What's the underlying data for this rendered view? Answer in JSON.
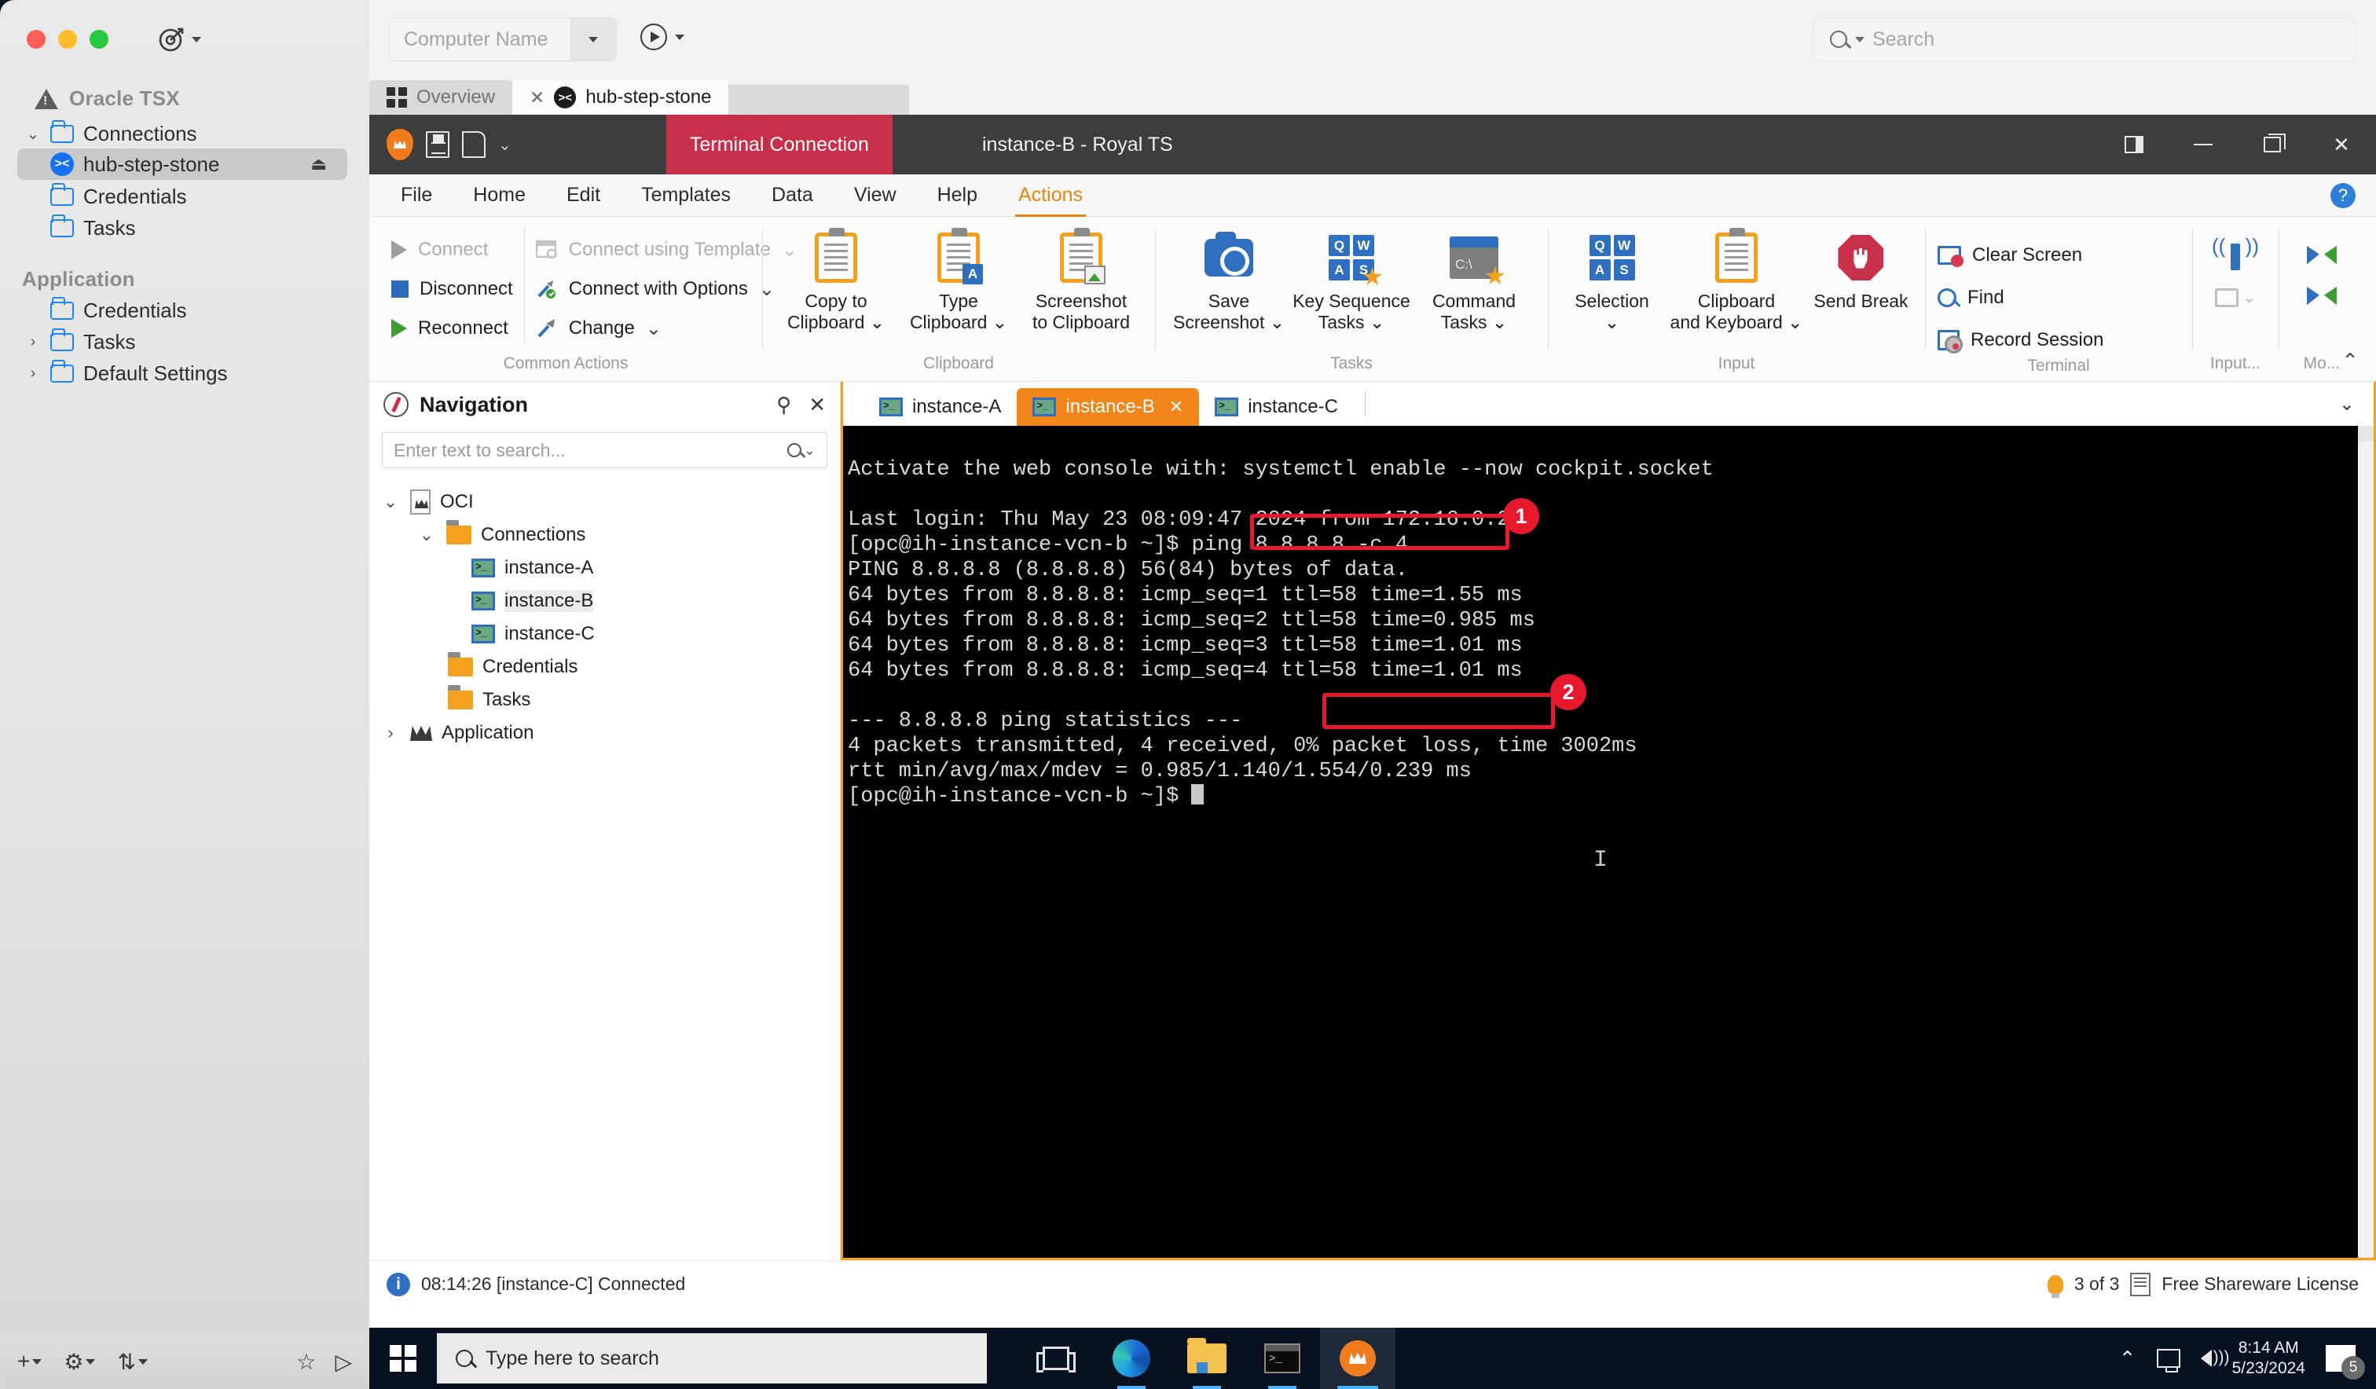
{
  "mac_sidebar": {
    "group1_title": "Oracle TSX",
    "items": [
      {
        "label": "Connections",
        "icon": "folder-icon",
        "twisty": "chevron-down"
      },
      {
        "label": "hub-step-stone",
        "icon": "xshell-icon",
        "selected": true,
        "trailing": "eject-icon"
      },
      {
        "label": "Credentials",
        "icon": "folder-icon"
      },
      {
        "label": "Tasks",
        "icon": "folder-icon"
      }
    ],
    "group2_title": "Application",
    "items2": [
      {
        "label": "Credentials",
        "icon": "folder-icon"
      },
      {
        "label": "Tasks",
        "icon": "folder-icon",
        "twisty": "chevron-right"
      },
      {
        "label": "Default Settings",
        "icon": "folder-icon",
        "twisty": "chevron-right"
      }
    ],
    "bottom_icons": [
      "plus-icon",
      "gear-icon",
      "transfer-icon",
      "star-icon",
      "play-icon"
    ]
  },
  "host_top": {
    "computer_name_placeholder": "Computer Name",
    "search_placeholder": "Search"
  },
  "host_tabs": [
    {
      "label": "Overview",
      "icon": "grid-icon",
      "active": false
    },
    {
      "label": "hub-step-stone",
      "icon": "xshell-icon",
      "active": true,
      "closable": true
    }
  ],
  "rts": {
    "connection_type_badge": "Terminal Connection",
    "window_title": "instance-B - Royal TS",
    "menu": [
      "File",
      "Home",
      "Edit",
      "Templates",
      "Data",
      "View",
      "Help",
      "Actions"
    ],
    "menu_active": "Actions",
    "window_buttons": [
      "panel-icon",
      "minimize-icon",
      "restore-icon",
      "close-icon"
    ],
    "help_button": "?"
  },
  "ribbon": {
    "groups": [
      {
        "label": "Common Actions",
        "simple_left": [
          {
            "label": "Connect",
            "icon": "play-icon",
            "disabled": true
          },
          {
            "label": "Disconnect",
            "icon": "stop-square-icon",
            "disabled": false
          },
          {
            "label": "Reconnect",
            "icon": "play-green-icon",
            "disabled": false
          }
        ],
        "simple_right": [
          {
            "label": "Connect using Template",
            "icon": "template-icon",
            "disabled": true,
            "caret": true
          },
          {
            "label": "Connect with Options",
            "icon": "wrench-icon",
            "disabled": false,
            "caret": true
          },
          {
            "label": "Change",
            "icon": "hammer-icon",
            "disabled": false,
            "caret": true
          }
        ]
      },
      {
        "label": "Clipboard",
        "buttons": [
          {
            "line1": "Copy to",
            "line2": "Clipboard",
            "icon": "clipboard-icon",
            "caret": true
          },
          {
            "line1": "Type",
            "line2": "Clipboard",
            "icon": "clipboard-type-icon",
            "caret": true
          },
          {
            "line1": "Screenshot",
            "line2": "to Clipboard",
            "icon": "clipboard-image-icon",
            "caret": false
          }
        ]
      },
      {
        "label": "Tasks",
        "buttons": [
          {
            "line1": "Save",
            "line2": "Screenshot",
            "icon": "camera-icon",
            "caret": true
          },
          {
            "line1": "Key Sequence",
            "line2": "Tasks",
            "icon": "keys-star-icon",
            "caret": true
          },
          {
            "line1": "Command",
            "line2": "Tasks",
            "icon": "command-star-icon",
            "caret": true
          }
        ]
      },
      {
        "label": "Input",
        "buttons": [
          {
            "line1": "Selection",
            "line2": "",
            "icon": "keys-icon",
            "caret": true
          },
          {
            "line1": "Clipboard",
            "line2": "and Keyboard",
            "icon": "clipboard-plain-icon",
            "caret": true
          },
          {
            "line1": "Send Break",
            "line2": "",
            "icon": "stop-hand-icon",
            "caret": false
          }
        ]
      },
      {
        "label": "Terminal",
        "items": [
          {
            "label": "Clear Screen",
            "icon": "clear-screen-icon"
          },
          {
            "label": "Find",
            "icon": "magnifier-icon"
          },
          {
            "label": "Record Session",
            "icon": "record-session-icon"
          }
        ]
      },
      {
        "label": "Input...",
        "icons": [
          "antenna-icon",
          "monitor-broadcast-icon"
        ]
      },
      {
        "label": "Mo...",
        "icons": [
          "bowtie-icon",
          "bowtie-icon"
        ]
      }
    ]
  },
  "navigation": {
    "title": "Navigation",
    "search_placeholder": "Enter text to search...",
    "header_icons": [
      "pin-icon",
      "close-icon"
    ],
    "tree": [
      {
        "label": "OCI",
        "icon": "document-crown-icon",
        "twisty": "chevron-down",
        "indent": 0
      },
      {
        "label": "Connections",
        "icon": "folder-orange-icon",
        "twisty": "chevron-down",
        "indent": 1
      },
      {
        "label": "instance-A",
        "icon": "terminal-icon",
        "indent": 2
      },
      {
        "label": "instance-B",
        "icon": "terminal-icon",
        "indent": 2,
        "highlight": true
      },
      {
        "label": "instance-C",
        "icon": "terminal-icon",
        "indent": 2
      },
      {
        "label": "Credentials",
        "icon": "folder-orange-icon",
        "indent": 1
      },
      {
        "label": "Tasks",
        "icon": "folder-orange-icon",
        "indent": 1
      },
      {
        "label": "Application",
        "icon": "crown-icon",
        "twisty": "chevron-right",
        "indent": 0
      }
    ]
  },
  "session_tabs": [
    {
      "label": "instance-A",
      "icon": "terminal-icon",
      "active": false
    },
    {
      "label": "instance-B",
      "icon": "terminal-icon",
      "active": true,
      "closable": true
    },
    {
      "label": "instance-C",
      "icon": "terminal-icon",
      "active": false
    }
  ],
  "terminal": {
    "lines": [
      "Activate the web console with: systemctl enable --now cockpit.socket",
      "",
      "Last login: Thu May 23 08:09:47 2024 from 172.16.0.252",
      "[opc@ih-instance-vcn-b ~]$ ping 8.8.8.8 -c 4",
      "PING 8.8.8.8 (8.8.8.8) 56(84) bytes of data.",
      "64 bytes from 8.8.8.8: icmp_seq=1 ttl=58 time=1.55 ms",
      "64 bytes from 8.8.8.8: icmp_seq=2 ttl=58 time=0.985 ms",
      "64 bytes from 8.8.8.8: icmp_seq=3 ttl=58 time=1.01 ms",
      "64 bytes from 8.8.8.8: icmp_seq=4 ttl=58 time=1.01 ms",
      "",
      "--- 8.8.8.8 ping statistics ---",
      "4 packets transmitted, 4 received, 0% packet loss, time 3002ms",
      "rtt min/avg/max/mdev = 0.985/1.140/1.554/0.239 ms"
    ],
    "prompt": "[opc@ih-instance-vcn-b ~]$ ",
    "annotations": [
      {
        "number": "1",
        "target": "ping 8.8.8.8 -c 4"
      },
      {
        "number": "2",
        "target": "0% packet loss,"
      }
    ]
  },
  "status_bar": {
    "message": "08:14:26 [instance-C] Connected",
    "connections_count": "3 of 3",
    "license": "Free Shareware License"
  },
  "taskbar": {
    "search_placeholder": "Type here to search",
    "apps": [
      "task-view-icon",
      "edge-icon",
      "file-explorer-icon",
      "command-prompt-icon",
      "royalts-icon"
    ],
    "clock_time": "8:14 AM",
    "clock_date": "5/23/2024",
    "notification_count": "5"
  },
  "colors": {
    "ribbon_accent": "#e8850f",
    "terminal_tab_active": "#f2861a",
    "annotation_red": "#e8192c",
    "connection_badge": "#c8304a"
  }
}
